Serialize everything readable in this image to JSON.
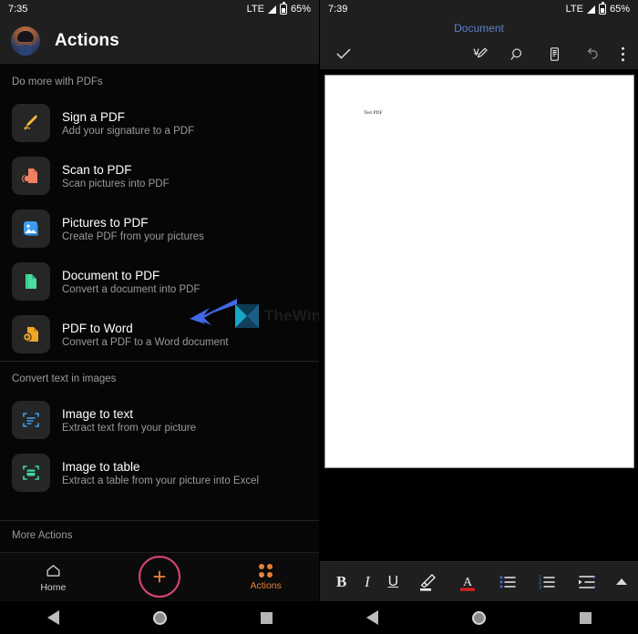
{
  "left": {
    "status_bar": {
      "time": "7:35",
      "network": "LTE",
      "battery": "65%"
    },
    "header": {
      "title": "Actions",
      "avatar": "user-avatar"
    },
    "sections": [
      {
        "label": "Do more with PDFs",
        "items": [
          {
            "title": "Sign a PDF",
            "subtitle": "Add your signature to a PDF",
            "icon": "pen-icon",
            "color": "#f5bb37"
          },
          {
            "title": "Scan to PDF",
            "subtitle": "Scan pictures into PDF",
            "icon": "scan-document-icon",
            "color": "#ef8064"
          },
          {
            "title": "Pictures to PDF",
            "subtitle": "Create PDF from your pictures",
            "icon": "picture-icon",
            "color": "#3d9df0"
          },
          {
            "title": "Document to PDF",
            "subtitle": "Convert a document into PDF",
            "icon": "document-icon",
            "color": "#4bdca3"
          },
          {
            "title": "PDF to Word",
            "subtitle": "Convert a PDF to a Word document",
            "icon": "pdf-to-word-icon",
            "color": "#f0a728"
          }
        ]
      },
      {
        "label": "Convert text in images",
        "items": [
          {
            "title": "Image to text",
            "subtitle": "Extract text from your picture",
            "icon": "scan-text-icon",
            "color": "#3d9df0"
          },
          {
            "title": "Image to table",
            "subtitle": "Extract a table from your picture into Excel",
            "icon": "scan-table-icon",
            "color": "#3fd99a"
          }
        ]
      }
    ],
    "more_actions_label": "More Actions",
    "navbar": {
      "home_label": "Home",
      "actions_label": "Actions",
      "fab": "add-button",
      "active_tab": "Actions",
      "active_color": "#e8803a"
    },
    "system_nav": [
      "back-button",
      "home-button",
      "recents-button"
    ]
  },
  "annotation": {
    "arrow": "pointing-arrow",
    "arrow_color": "#4169e8",
    "watermark_text": "TheWindowsClub"
  },
  "right": {
    "status_bar": {
      "time": "7:39",
      "network": "LTE",
      "battery": "65%"
    },
    "document_title": "Document",
    "document_title_color": "#5b7fc7",
    "toolbar": {
      "confirm": "checkmark-icon",
      "items": [
        "ink-pen-icon",
        "search-icon",
        "mobile-view-icon",
        "undo-icon",
        "overflow-menu-icon"
      ]
    },
    "page": {
      "text": "Test PDF"
    },
    "format_bar": {
      "items": [
        {
          "label": "B",
          "name": "bold-button"
        },
        {
          "label": "I",
          "name": "italic-button"
        },
        {
          "label": "U",
          "name": "underline-button"
        },
        {
          "label": "",
          "name": "highlight-button"
        },
        {
          "label": "A",
          "name": "font-color-button"
        },
        {
          "label": "",
          "name": "bulleted-list-button"
        },
        {
          "label": "",
          "name": "numbered-list-button"
        },
        {
          "label": "",
          "name": "indent-button"
        },
        {
          "label": "",
          "name": "collapse-toolbar-button"
        }
      ]
    },
    "system_nav": [
      "back-button",
      "home-button",
      "recents-button"
    ]
  }
}
